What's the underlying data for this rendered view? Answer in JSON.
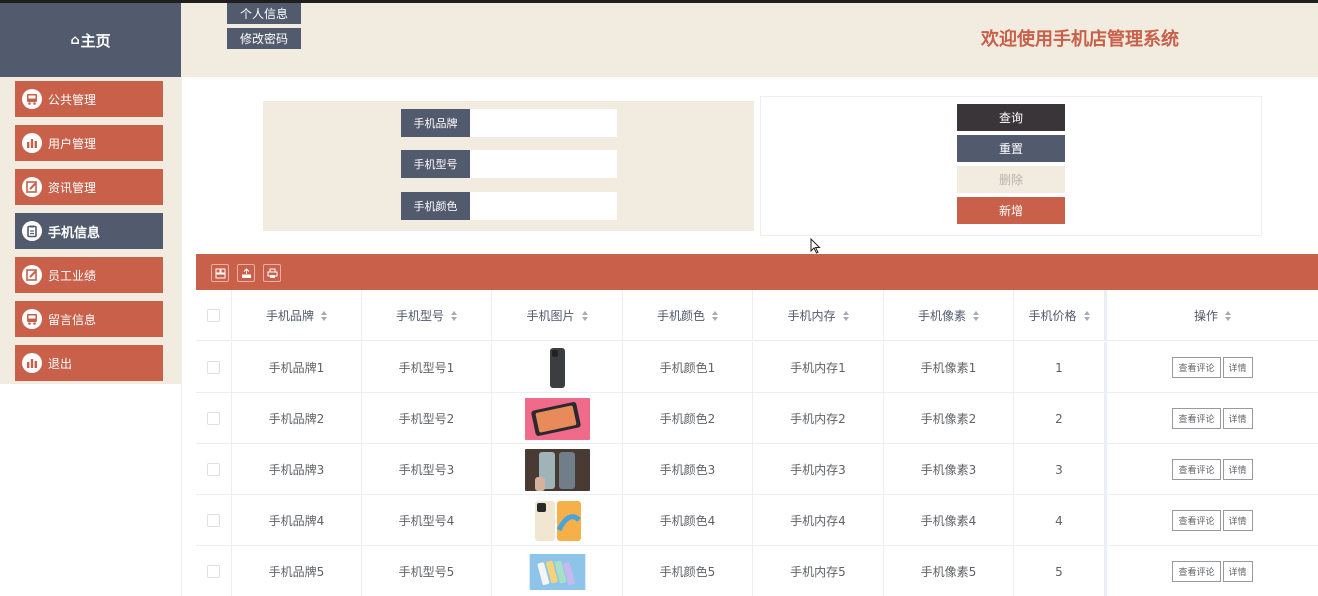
{
  "brand": {
    "icon": "home-icon",
    "label": "主页"
  },
  "header": {
    "buttons": [
      "个人信息",
      "修改密码"
    ],
    "title": "欢迎使用手机店管理系统"
  },
  "sidebar": {
    "items": [
      {
        "label": "公共管理",
        "icon": "bus-icon"
      },
      {
        "label": "用户管理",
        "icon": "bar-chart-icon"
      },
      {
        "label": "资讯管理",
        "icon": "edit-icon"
      },
      {
        "label": "手机信息",
        "icon": "clipboard-icon",
        "active": true
      },
      {
        "label": "员工业绩",
        "icon": "edit-icon"
      },
      {
        "label": "留言信息",
        "icon": "bus-icon"
      },
      {
        "label": "退出",
        "icon": "bar-chart-icon"
      }
    ]
  },
  "search": {
    "fields": [
      {
        "label": "手机品牌",
        "value": ""
      },
      {
        "label": "手机型号",
        "value": ""
      },
      {
        "label": "手机颜色",
        "value": ""
      }
    ]
  },
  "actions": {
    "query": "查询",
    "reset": "重置",
    "delete": "删除",
    "add": "新增"
  },
  "toolbar": {
    "icons": [
      "grid-icon",
      "export-icon",
      "print-icon"
    ]
  },
  "table": {
    "columns": [
      "手机品牌",
      "手机型号",
      "手机图片",
      "手机颜色",
      "手机内存",
      "手机像素",
      "手机价格",
      "操作"
    ],
    "rows": [
      {
        "brand": "手机品牌1",
        "model": "手机型号1",
        "color": "手机颜色1",
        "memory": "手机内存1",
        "pixels": "手机像素1",
        "price": "1"
      },
      {
        "brand": "手机品牌2",
        "model": "手机型号2",
        "color": "手机颜色2",
        "memory": "手机内存2",
        "pixels": "手机像素2",
        "price": "2"
      },
      {
        "brand": "手机品牌3",
        "model": "手机型号3",
        "color": "手机颜色3",
        "memory": "手机内存3",
        "pixels": "手机像素3",
        "price": "3"
      },
      {
        "brand": "手机品牌4",
        "model": "手机型号4",
        "color": "手机颜色4",
        "memory": "手机内存4",
        "pixels": "手机像素4",
        "price": "4"
      },
      {
        "brand": "手机品牌5",
        "model": "手机型号5",
        "color": "手机颜色5",
        "memory": "手机内存5",
        "pixels": "手机像素5",
        "price": "5"
      }
    ],
    "row_actions": [
      "查看评论",
      "详情"
    ]
  },
  "colors": {
    "accent": "#c8604a",
    "dark": "#525a6e",
    "beige": "#f1ebe0",
    "query": "#3a3538"
  }
}
